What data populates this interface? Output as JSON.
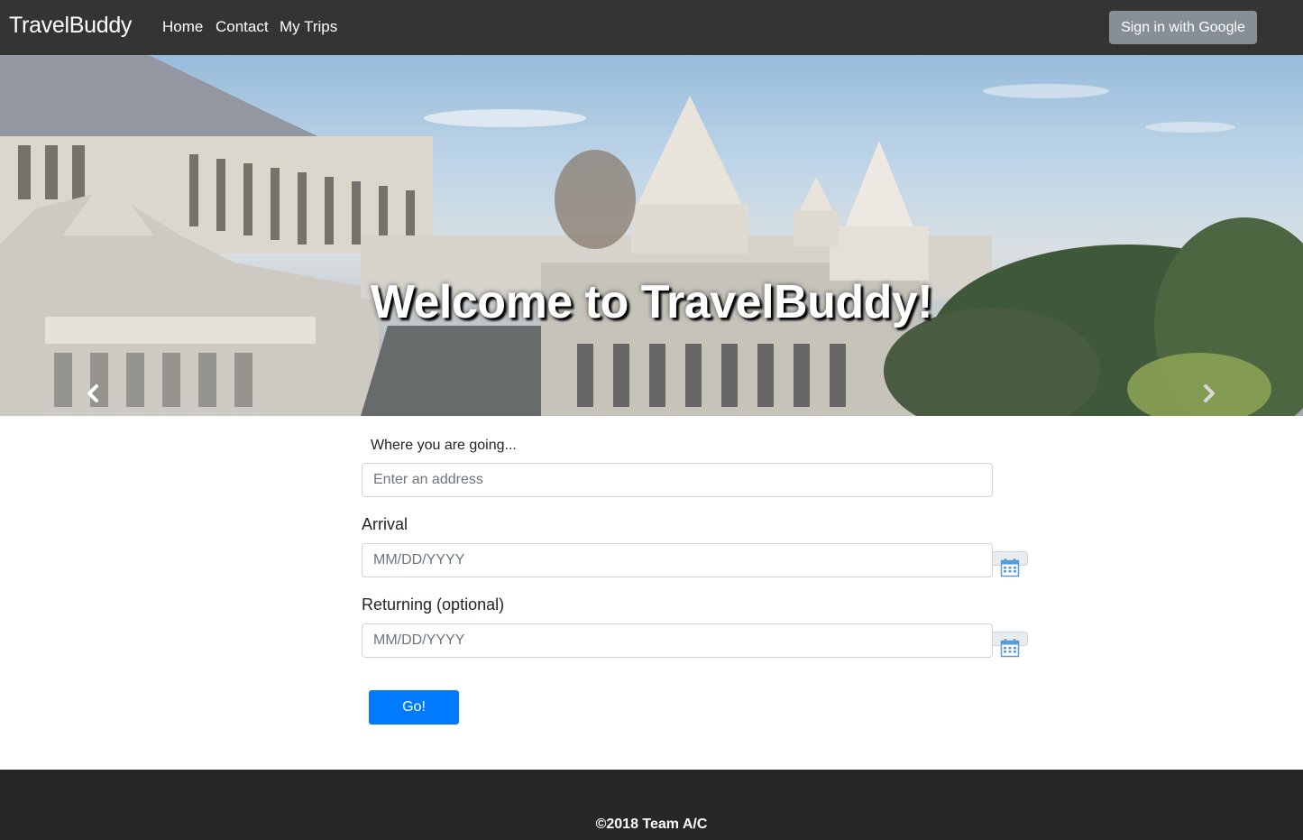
{
  "navbar": {
    "brand": "TravelBuddy",
    "links": [
      "Home",
      "Contact",
      "My Trips"
    ],
    "signin_label": "Sign in with Google"
  },
  "hero": {
    "title": "Welcome to TravelBuddy!",
    "prev_icon": "chevron-left-icon",
    "next_icon": "chevron-right-icon"
  },
  "form": {
    "destination_label": "Where you are going...",
    "destination_placeholder": "Enter an address",
    "arrival_label": "Arrival",
    "arrival_placeholder": "MM/DD/YYYY",
    "returning_label": "Returning (optional)",
    "returning_placeholder": "MM/DD/YYYY",
    "calendar_icon": "calendar-icon",
    "go_label": "Go!"
  },
  "footer": {
    "copyright": "©2018 Team A/C"
  },
  "colors": {
    "navbar_bg": "#343434",
    "signin_bg": "#868e96",
    "primary": "#007bff",
    "footer_bg": "#272727",
    "calendar_icon": "#5b9bd5"
  }
}
